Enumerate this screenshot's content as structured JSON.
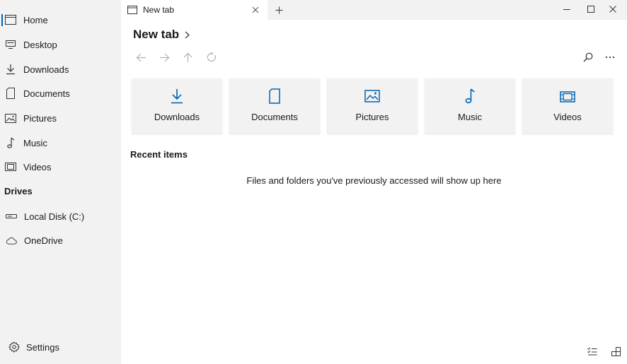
{
  "sidebar": {
    "items": [
      {
        "label": "Home",
        "icon": "home-icon"
      },
      {
        "label": "Desktop",
        "icon": "desktop-icon"
      },
      {
        "label": "Downloads",
        "icon": "download-icon"
      },
      {
        "label": "Documents",
        "icon": "document-icon"
      },
      {
        "label": "Pictures",
        "icon": "picture-icon"
      },
      {
        "label": "Music",
        "icon": "music-icon"
      },
      {
        "label": "Videos",
        "icon": "video-icon"
      }
    ],
    "drives_header": "Drives",
    "drives": [
      {
        "label": "Local Disk (C:)",
        "icon": "drive-icon"
      },
      {
        "label": "OneDrive",
        "icon": "cloud-icon"
      }
    ],
    "settings_label": "Settings"
  },
  "tabs": [
    {
      "label": "New tab"
    }
  ],
  "main": {
    "breadcrumb": "New tab",
    "quick_access": [
      {
        "label": "Downloads",
        "icon": "download-icon"
      },
      {
        "label": "Documents",
        "icon": "document-icon"
      },
      {
        "label": "Pictures",
        "icon": "picture-icon"
      },
      {
        "label": "Music",
        "icon": "music-icon"
      },
      {
        "label": "Videos",
        "icon": "video-icon"
      }
    ],
    "recent_title": "Recent items",
    "empty_message": "Files and folders you've previously accessed will show up here"
  },
  "colors": {
    "accent": "#0063b1",
    "sidebar_bg": "#f2f2f2",
    "card_bg": "#f2f2f2"
  }
}
